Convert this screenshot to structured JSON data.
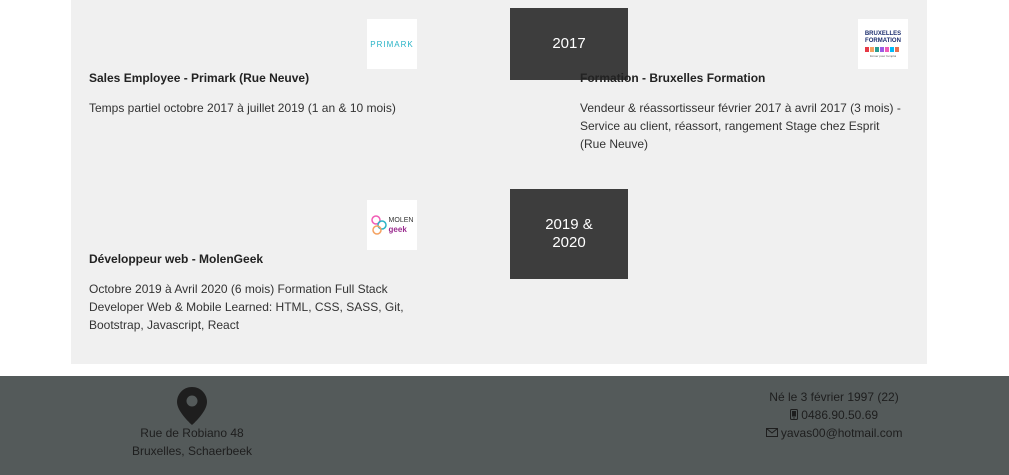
{
  "timeline": {
    "rows": [
      {
        "year": "2017",
        "left": {
          "logo_text": "PRIMARK",
          "title": "Sales Employee - Primark (Rue Neuve)",
          "description": "Temps partiel octobre 2017 à juillet 2019 (1 an & 10 mois)"
        },
        "right": {
          "logo_line1": "BRUXELLES",
          "logo_line2": "FORMATION",
          "logo_tagline": "former pour l'emploi",
          "title": "Formation - Bruxelles Formation",
          "description_lines": [
            "Vendeur & réassortisseur février 2017 à avril 2017 (3 mois) -",
            "Service au client, réassort, rangement Stage chez Esprit",
            "(Rue Neuve)"
          ]
        }
      },
      {
        "year_lines": [
          "2019 &",
          "2020"
        ],
        "left": {
          "logo_text_top": "MOLEN",
          "logo_text_bottom": "geek",
          "title": "Développeur web - MolenGeek",
          "description_lines": [
            "Octobre 2019 à Avril 2020 (6 mois) Formation Full Stack",
            "Developer Web & Mobile Learned: HTML, CSS, SASS, Git,",
            "Bootstrap, Javascript, React"
          ]
        }
      }
    ]
  },
  "footer": {
    "location_icon": "map-pin-icon",
    "address_line1": "Rue de Robiano 48",
    "address_line2": "Bruxelles, Schaerbeek",
    "birth": "Né le 3 février 1997 (22)",
    "phone_icon": "phone-icon",
    "phone": "0486.90.50.69",
    "email_icon": "envelope-icon",
    "email": "yavas00@hotmail.com"
  },
  "colors": {
    "timeline_bg": "#f0f0f0",
    "year_box": "#3d3d3d",
    "footer_bg": "#545a5a"
  }
}
